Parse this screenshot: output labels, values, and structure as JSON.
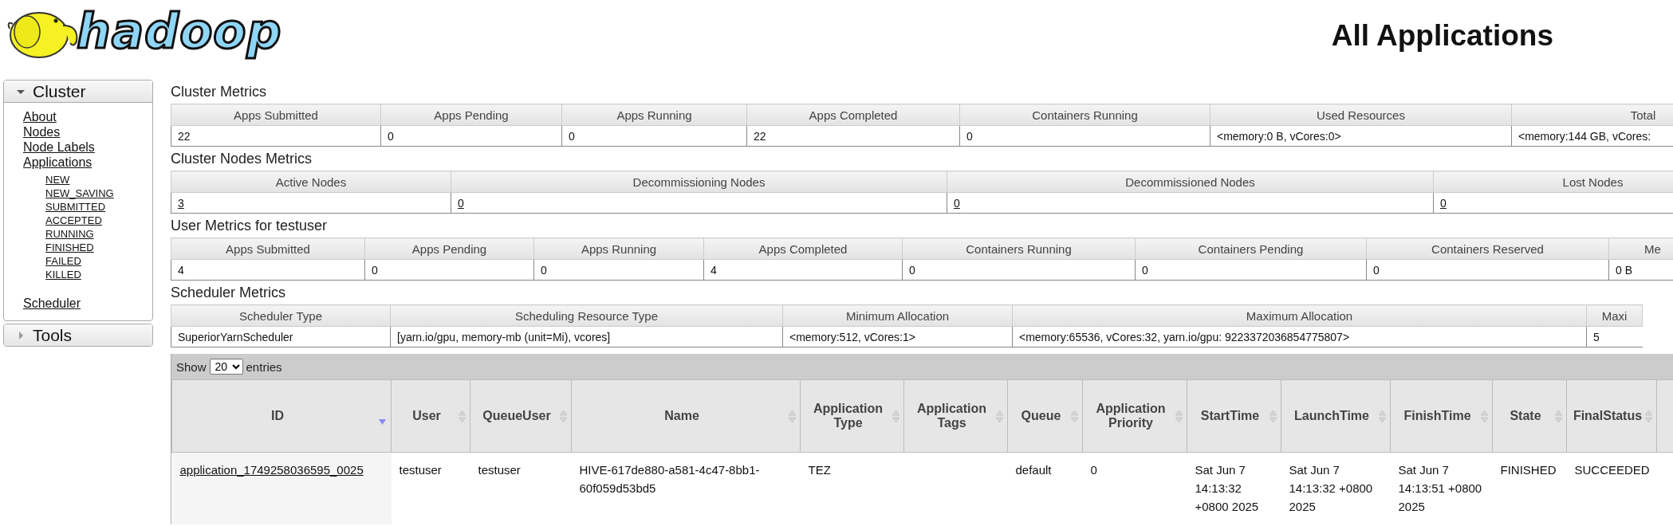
{
  "logo": {
    "text": "hadoop"
  },
  "page_title": "All Applications",
  "sidebar": [
    {
      "title": "Cluster",
      "expanded": true,
      "items": [
        {
          "label": "About"
        },
        {
          "label": "Nodes"
        },
        {
          "label": "Node Labels"
        },
        {
          "label": "Applications",
          "children": [
            {
              "label": "NEW"
            },
            {
              "label": "NEW_SAVING"
            },
            {
              "label": "SUBMITTED"
            },
            {
              "label": "ACCEPTED"
            },
            {
              "label": "RUNNING"
            },
            {
              "label": "FINISHED"
            },
            {
              "label": "FAILED"
            },
            {
              "label": "KILLED"
            }
          ]
        },
        {
          "label": "Scheduler"
        }
      ]
    },
    {
      "title": "Tools",
      "expanded": false
    }
  ],
  "metrics_sections": [
    {
      "title": "Cluster Metrics",
      "columns": [
        "Apps Submitted",
        "Apps Pending",
        "Apps Running",
        "Apps Completed",
        "Containers Running",
        "Used Resources",
        "Total"
      ],
      "values": [
        {
          "text": "22",
          "link": false
        },
        {
          "text": "0",
          "link": false
        },
        {
          "text": "0",
          "link": false
        },
        {
          "text": "22",
          "link": false
        },
        {
          "text": "0",
          "link": false
        },
        {
          "text": "<memory:0 B, vCores:0>",
          "link": false
        },
        {
          "text": "<memory:144 GB, vCores:",
          "link": false
        }
      ]
    },
    {
      "title": "Cluster Nodes Metrics",
      "columns": [
        "Active Nodes",
        "Decommissioning Nodes",
        "Decommissioned Nodes",
        "Lost Nodes"
      ],
      "values": [
        {
          "text": "3",
          "link": true
        },
        {
          "text": "0",
          "link": true
        },
        {
          "text": "0",
          "link": true
        },
        {
          "text": "0",
          "link": true
        }
      ]
    },
    {
      "title": "User Metrics for testuser",
      "columns": [
        "Apps Submitted",
        "Apps Pending",
        "Apps Running",
        "Apps Completed",
        "Containers Running",
        "Containers Pending",
        "Containers Reserved",
        "Me"
      ],
      "values": [
        {
          "text": "4",
          "link": false
        },
        {
          "text": "0",
          "link": false
        },
        {
          "text": "0",
          "link": false
        },
        {
          "text": "4",
          "link": false
        },
        {
          "text": "0",
          "link": false
        },
        {
          "text": "0",
          "link": false
        },
        {
          "text": "0",
          "link": false
        },
        {
          "text": "0 B",
          "link": false
        }
      ]
    },
    {
      "title": "Scheduler Metrics",
      "columns": [
        "Scheduler Type",
        "Scheduling Resource Type",
        "Minimum Allocation",
        "Maximum Allocation",
        "Maxi"
      ],
      "values": [
        {
          "text": "SuperiorYarnScheduler",
          "link": false
        },
        {
          "text": "[yarn.io/gpu, memory-mb (unit=Mi), vcores]",
          "link": false
        },
        {
          "text": "<memory:512, vCores:1>",
          "link": false
        },
        {
          "text": "<memory:65536, vCores:32, yarn.io/gpu: 9223372036854775807>",
          "link": false
        },
        {
          "text": "5",
          "link": false
        }
      ]
    }
  ],
  "applications": {
    "show_entries": {
      "prefix": "Show",
      "value": "20",
      "suffix": "entries"
    },
    "columns": [
      {
        "label": "ID",
        "sorted": true
      },
      {
        "label": "User",
        "sorted": false
      },
      {
        "label": "QueueUser",
        "sorted": false
      },
      {
        "label": "Name",
        "sorted": false
      },
      {
        "label": "Application Type",
        "sorted": false
      },
      {
        "label": "Application Tags",
        "sorted": false
      },
      {
        "label": "Queue",
        "sorted": false
      },
      {
        "label": "Application Priority",
        "sorted": false
      },
      {
        "label": "StartTime",
        "sorted": false
      },
      {
        "label": "LaunchTime",
        "sorted": false
      },
      {
        "label": "FinishTime",
        "sorted": false
      },
      {
        "label": "State",
        "sorted": false
      },
      {
        "label": "FinalStatus",
        "sorted": false
      }
    ],
    "rows": [
      {
        "cells": [
          {
            "text": "application_1749258036595_0025",
            "link": true
          },
          {
            "text": "testuser",
            "link": false
          },
          {
            "text": "testuser",
            "link": false
          },
          {
            "text": "HIVE-617de880-a581-4c47-8bb1-60f059d53bd5",
            "link": false
          },
          {
            "text": "TEZ",
            "link": false
          },
          null,
          {
            "text": "default",
            "link": false
          },
          {
            "text": "0",
            "link": false
          },
          {
            "text": "Sat Jun 7 14:13:32 +0800 2025",
            "link": false
          },
          {
            "text": "Sat Jun 7 14:13:32 +0800 2025",
            "link": false
          },
          {
            "text": "Sat Jun 7 14:13:51 +0800 2025",
            "link": false
          },
          {
            "text": "FINISHED",
            "link": false
          },
          {
            "text": "SUCCEEDED",
            "link": false
          }
        ]
      }
    ]
  }
}
